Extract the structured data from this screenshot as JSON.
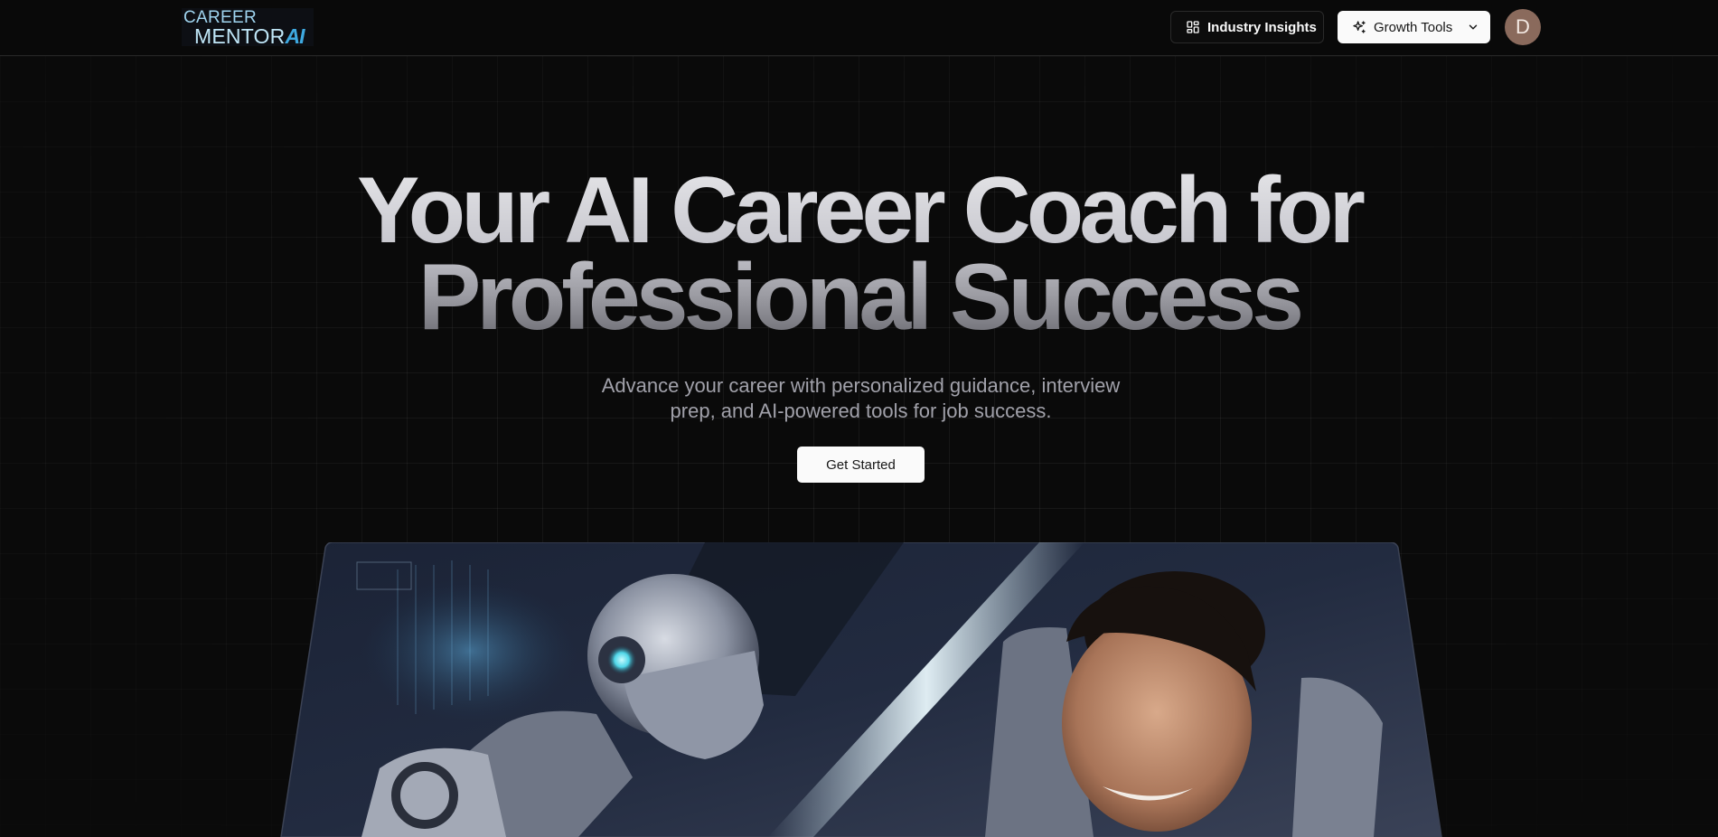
{
  "header": {
    "logo": {
      "line1": "CAREER",
      "line2": "MENTOR",
      "suffix": "AI"
    },
    "nav": {
      "insights_label": "Industry Insights",
      "insights_icon": "layout-dashboard-icon",
      "growth_label": "Growth Tools",
      "growth_icon": "stars-icon",
      "growth_chevron": "chevron-down-icon"
    },
    "avatar_initial": "D"
  },
  "hero": {
    "title_line1": "Your AI Career Coach for",
    "title_line2": "Professional Success",
    "subtitle": "Advance your career with personalized guidance, interview prep, and AI-powered tools for job success.",
    "cta_label": "Get Started"
  },
  "colors": {
    "background": "#0a0a0a",
    "primary_button": "#fafafa",
    "muted_text": "#a1a1aa",
    "avatar_bg": "#8a6a5c"
  }
}
